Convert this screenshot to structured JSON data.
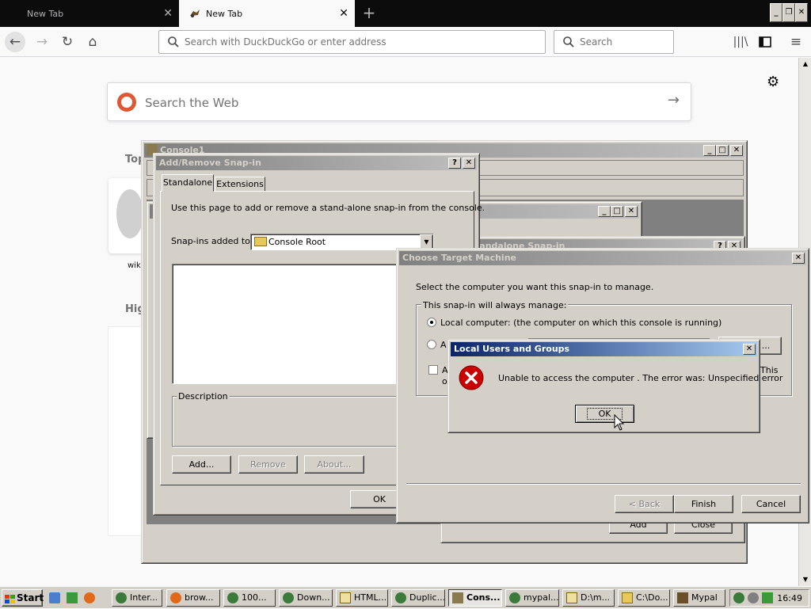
{
  "browser": {
    "tabs": [
      {
        "label": "New Tab",
        "active": false
      },
      {
        "label": "New Tab",
        "active": true
      }
    ],
    "urlbar_placeholder": "Search with DuckDuckGo or enter address",
    "searchbar_placeholder": "Search"
  },
  "newtab": {
    "search_placeholder": "Search the Web",
    "fragments": {
      "top": "Top",
      "wiki": "wik",
      "high": "Hig"
    }
  },
  "console": {
    "title": "Console1"
  },
  "snapin_dialog": {
    "title": "Add/Remove Snap-in",
    "tabs": [
      "Standalone",
      "Extensions"
    ],
    "intro": "Use this page to add or remove a stand-alone snap-in from the console.",
    "snapins_label": "Snap-ins added to:",
    "snapins_value": "Console Root",
    "description_label": "Description",
    "add_label": "Add...",
    "remove_label": "Remove",
    "about_label": "About...",
    "ok_label": "OK"
  },
  "standalone_dialog": {
    "title": "Add Standalone Snap-in",
    "add_label": "Add",
    "close_label": "Close"
  },
  "target_dialog": {
    "title": "Choose Target Machine",
    "prompt": "Select the computer you want this snap-in to manage.",
    "group_label": "This snap-in will always manage:",
    "local_label": "Local computer:  (the computer on which this console is running)",
    "another_label": "A",
    "checkbox_frag": "A",
    "checkbox_frag2": "o",
    "this_frag": "This",
    "browse_frag": "...",
    "back_label": "< Back",
    "finish_label": "Finish",
    "cancel_label": "Cancel"
  },
  "error_dialog": {
    "title": "Local Users and Groups",
    "message": "Unable to access the computer .  The error was: Unspecified error",
    "ok_label": "OK"
  },
  "taskbar": {
    "start_label": "Start",
    "tasks": [
      "Inter...",
      "brow...",
      "100...",
      "Down...",
      "HTML...",
      "Duplic...",
      "Cons...",
      "mypal...",
      "D:\\m...",
      "C:\\Do...",
      "Mypal"
    ],
    "clock": "16:49"
  },
  "colors": {
    "active_title_start": "#0a246a",
    "active_title_end": "#a6caf0",
    "inactive_title": "#808080",
    "error_red": "#cc0000",
    "ddg_orange": "#de5833"
  }
}
